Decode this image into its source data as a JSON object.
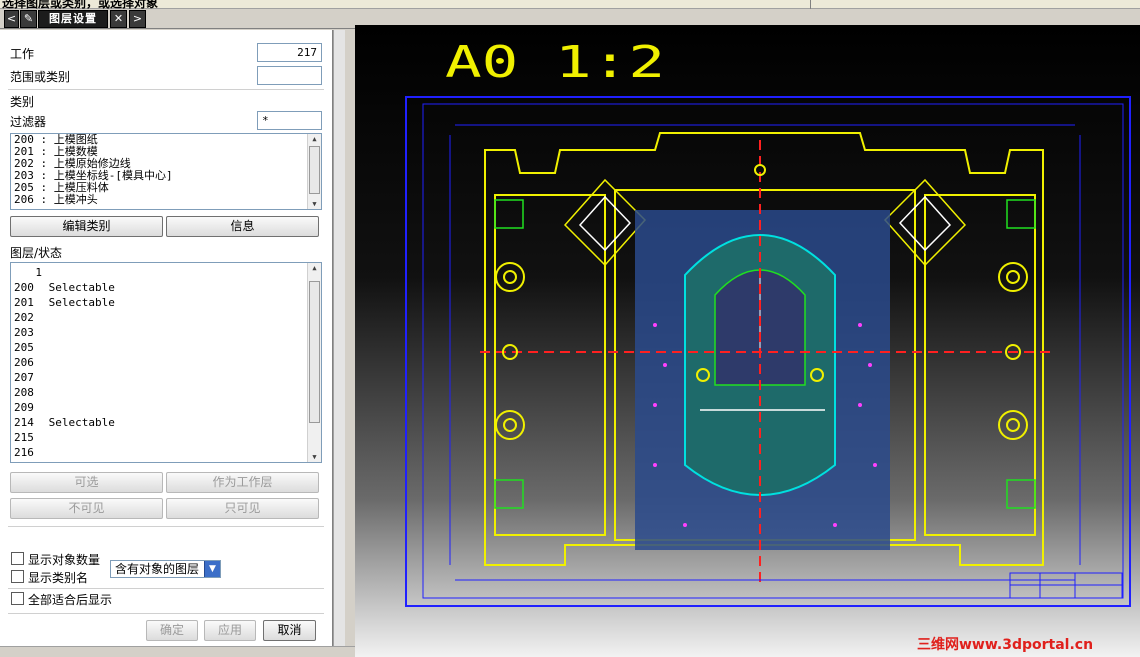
{
  "window": {
    "prompt_text": "选择图层或类别，或选择对象",
    "tabs": {
      "panel_title": "图层设置"
    }
  },
  "panel": {
    "work_label": "工作",
    "work_value": "217",
    "range_label": "范围或类别",
    "range_value": "",
    "category_section": "类别",
    "filter_label": "过滤器",
    "filter_value": "*",
    "categories": [
      "200 : 上模图纸",
      "201 : 上模数模",
      "202 : 上模原始修边线",
      "203 : 上模坐标线-[模具中心]",
      "205 : 上模压料体",
      "206 : 上模冲头"
    ],
    "edit_category_button": "编辑类别",
    "info_button": "信息",
    "layer_status_label": "图层/状态",
    "layers": [
      {
        "num": "1",
        "status": ""
      },
      {
        "num": "200",
        "status": "Selectable"
      },
      {
        "num": "201",
        "status": "Selectable"
      },
      {
        "num": "202",
        "status": ""
      },
      {
        "num": "203",
        "status": ""
      },
      {
        "num": "205",
        "status": ""
      },
      {
        "num": "206",
        "status": ""
      },
      {
        "num": "207",
        "status": ""
      },
      {
        "num": "208",
        "status": ""
      },
      {
        "num": "209",
        "status": ""
      },
      {
        "num": "214",
        "status": "Selectable"
      },
      {
        "num": "215",
        "status": ""
      },
      {
        "num": "216",
        "status": ""
      }
    ],
    "selectable_button": "可选",
    "make_work_button": "作为工作层",
    "invisible_button": "不可见",
    "visible_only_button": "只可见",
    "layer_filter_option": "含有对象的图层",
    "show_object_count": "显示对象数量",
    "show_category_name": "显示类别名",
    "fit_all_display": "全部适合后显示",
    "ok_button": "确定",
    "apply_button": "应用",
    "cancel_button": "取消"
  },
  "drawing": {
    "sheet_title": "A0 1:2",
    "watermark": "三维网www.3dportal.cn"
  },
  "colors": {
    "drawing_yellow": "#f0f000",
    "drawing_blue": "#2020ff",
    "drawing_cyan": "#00e0e0",
    "drawing_red": "#ff2020",
    "drawing_green": "#20e020",
    "drawing_fill": "#2a4a8c"
  }
}
